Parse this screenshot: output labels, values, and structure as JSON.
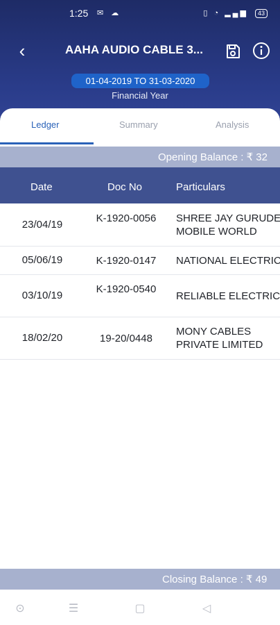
{
  "status_bar": {
    "time": "1:25",
    "battery": "43"
  },
  "header": {
    "back_icon": "back-arrow-icon",
    "title": "AAHA AUDIO CABLE 3...",
    "save_icon": "save-icon",
    "info_icon": "info-icon"
  },
  "financial_year": {
    "range": "01-04-2019 TO 31-03-2020",
    "label": "Financial Year"
  },
  "tabs": [
    {
      "label": "Ledger",
      "active": true
    },
    {
      "label": "Summary",
      "active": false
    },
    {
      "label": "Analysis",
      "active": false
    }
  ],
  "opening_balance": "Opening Balance : ₹ 32",
  "table": {
    "headers": [
      "Date",
      "Doc No",
      "Particulars"
    ],
    "rows": [
      {
        "date": "23/04/19",
        "doc_no": "K-1920-0056",
        "particulars": "SHREE JAY GURUDE\nMOBILE WORLD"
      },
      {
        "date": "05/06/19",
        "doc_no": "K-1920-0147",
        "particulars": "NATIONAL ELECTRIC"
      },
      {
        "date": "03/10/19",
        "doc_no": "K-1920-0540",
        "particulars": "RELIABLE ELECTRIC"
      },
      {
        "date": "18/02/20",
        "doc_no": "19-20/0448",
        "particulars": "MONY CABLES\nPRIVATE LIMITED"
      }
    ]
  },
  "closing_balance": "Closing Balance : ₹ 49",
  "colors": {
    "header_bg": "#2a3c8a",
    "accent": "#2a62b8",
    "pill": "#1f63c9",
    "table_header": "#3f5190",
    "balance_bar": "#a7b1ce"
  }
}
